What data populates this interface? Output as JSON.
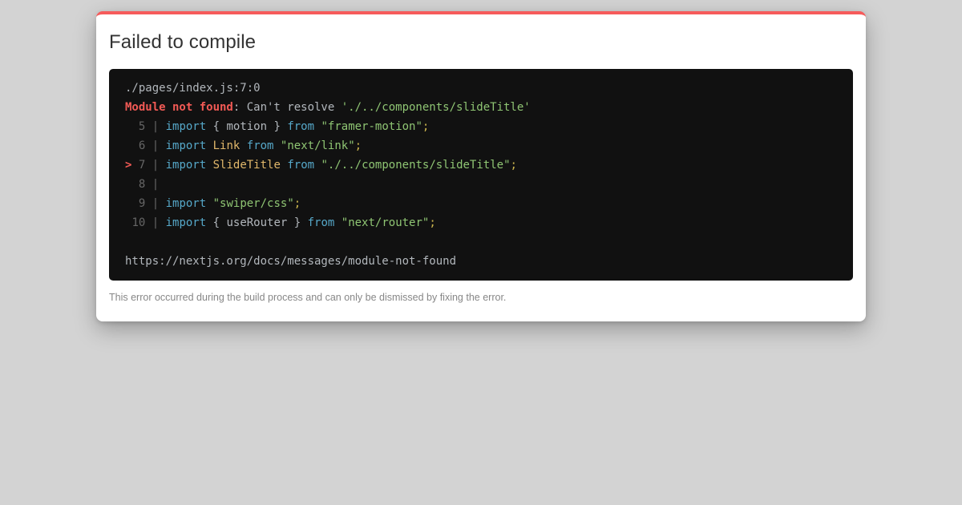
{
  "palette": {
    "page_bg": "#d3d3d3",
    "accent_red": "#f65b5b",
    "terminal_bg": "#111111",
    "ansi_fg": "#b2b7bc",
    "ansi_dim": "#666666",
    "ansi_red": "#f25a55",
    "ansi_cyan": "#56a8c9",
    "ansi_yellow": "#e2b86b",
    "ansi_green": "#8fc573",
    "ansi_punct": "#cdb74e"
  },
  "dialog": {
    "title": "Failed to compile",
    "footer_note": "This error occurred during the build process and can only be dismissed by fixing the error."
  },
  "terminal": {
    "file_location": "./pages/index.js:7:0",
    "error": {
      "label": "Module not found",
      "message": ": Can't resolve ",
      "module_path": "'./../components/slideTitle'"
    },
    "code_frame": [
      {
        "gutter": "  5 | ",
        "tokens": [
          [
            "kw",
            "import"
          ],
          [
            "plain",
            " { motion } "
          ],
          [
            "kw",
            "from"
          ],
          [
            "plain",
            " "
          ],
          [
            "str",
            "\"framer-motion\""
          ],
          [
            "punct",
            ";"
          ]
        ]
      },
      {
        "gutter": "  6 | ",
        "tokens": [
          [
            "kw",
            "import"
          ],
          [
            "plain",
            " "
          ],
          [
            "id",
            "Link"
          ],
          [
            "plain",
            " "
          ],
          [
            "kw",
            "from"
          ],
          [
            "plain",
            " "
          ],
          [
            "str",
            "\"next/link\""
          ],
          [
            "punct",
            ";"
          ]
        ]
      },
      {
        "gutter": "> 7 | ",
        "tokens": [
          [
            "kw",
            "import"
          ],
          [
            "plain",
            " "
          ],
          [
            "id",
            "SlideTitle"
          ],
          [
            "plain",
            " "
          ],
          [
            "kw",
            "from"
          ],
          [
            "plain",
            " "
          ],
          [
            "str",
            "\"./../components/slideTitle\""
          ],
          [
            "punct",
            ";"
          ]
        ]
      },
      {
        "gutter": "  8 | ",
        "tokens": []
      },
      {
        "gutter": "  9 | ",
        "tokens": [
          [
            "kw",
            "import"
          ],
          [
            "plain",
            " "
          ],
          [
            "str",
            "\"swiper/css\""
          ],
          [
            "punct",
            ";"
          ]
        ]
      },
      {
        "gutter": " 10 | ",
        "tokens": [
          [
            "kw",
            "import"
          ],
          [
            "plain",
            " { useRouter } "
          ],
          [
            "kw",
            "from"
          ],
          [
            "plain",
            " "
          ],
          [
            "str",
            "\"next/router\""
          ],
          [
            "punct",
            ";"
          ]
        ]
      }
    ],
    "docs_link": "https://nextjs.org/docs/messages/module-not-found"
  }
}
